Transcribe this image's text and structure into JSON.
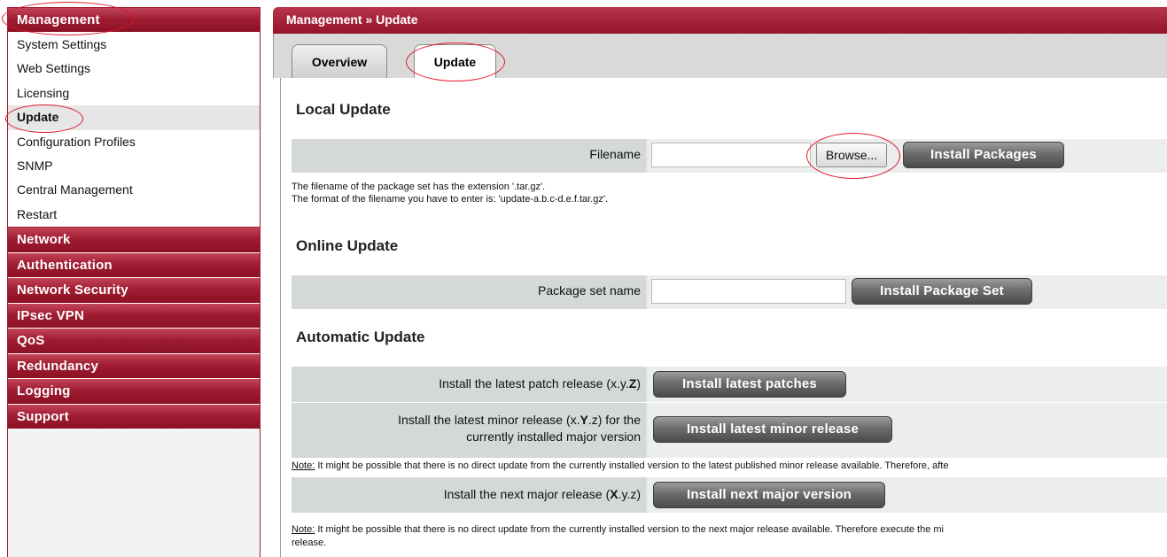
{
  "sidebar": {
    "management": {
      "title": "Management",
      "items": [
        "System Settings",
        "Web Settings",
        "Licensing",
        "Update",
        "Configuration Profiles",
        "SNMP",
        "Central Management",
        "Restart"
      ]
    },
    "sections": [
      "Network",
      "Authentication",
      "Network Security",
      "IPsec VPN",
      "QoS",
      "Redundancy",
      "Logging",
      "Support"
    ]
  },
  "breadcrumb": "Management » Update",
  "tabs": {
    "overview": "Overview",
    "update": "Update"
  },
  "local_update": {
    "title": "Local Update",
    "filename_label": "Filename",
    "filename_value": "",
    "browse_label": "Browse...",
    "install_label": "Install Packages",
    "hint_1": "The filename of the package set has the extension '.tar.gz'.",
    "hint_2": "The format of the filename you have to enter is: 'update-a.b.c-d.e.f.tar.gz'."
  },
  "online_update": {
    "title": "Online Update",
    "package_label": "Package set name",
    "package_value": "",
    "install_label": "Install Package Set"
  },
  "automatic_update": {
    "title": "Automatic Update",
    "patch_label_pre": "Install the latest patch release (x.y.",
    "patch_label_bold": "Z",
    "patch_label_post": ")",
    "patch_button": "Install latest patches",
    "minor_label_pre": "Install the latest minor release (x.",
    "minor_label_bold": "Y",
    "minor_label_post": ".z) for the",
    "minor_label_line2": "currently installed major version",
    "minor_button": "Install latest minor release",
    "note_word": "Note:",
    "minor_note": " It might be possible that there is no direct update from the currently installed version to the latest published minor release available. Therefore, afte",
    "major_label_pre": "Install the next major release (",
    "major_label_bold": "X",
    "major_label_post": ".y.z)",
    "major_button": "Install next major version",
    "major_note": " It might be possible that there is no direct update from the currently installed version to the next major release available. Therefore execute the mi",
    "major_note_line2": "release."
  },
  "colors": {
    "brand": "#a01c30",
    "highlight_circle": "#e0182a"
  }
}
